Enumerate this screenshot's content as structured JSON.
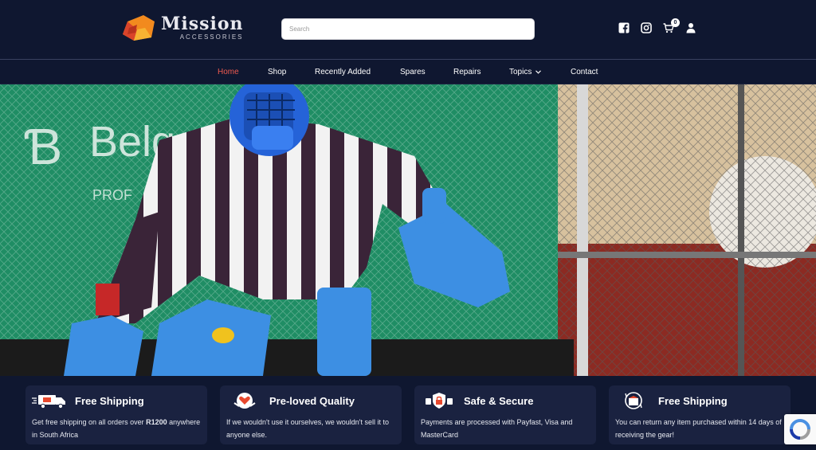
{
  "brand": {
    "name": "Mission",
    "tagline": "ACCESSORIES"
  },
  "search": {
    "placeholder": "Search",
    "value": ""
  },
  "header_icons": {
    "facebook": "facebook-icon",
    "instagram": "instagram-icon",
    "cart": "cart-icon",
    "account": "user-icon",
    "cart_count": "0"
  },
  "nav": {
    "items": [
      {
        "label": "Home",
        "active": true
      },
      {
        "label": "Shop"
      },
      {
        "label": "Recently Added"
      },
      {
        "label": "Spares"
      },
      {
        "label": "Repairs"
      },
      {
        "label": "Topics"
      },
      {
        "label": "Contact"
      }
    ]
  },
  "hero": {
    "image": "hockey goalkeeper in striped jersey and blue pads in front of green netting",
    "banner_text": "Belg ort",
    "banner_sub": "PROF"
  },
  "features": [
    {
      "icon": "shipping-truck-icon",
      "title": "Free Shipping",
      "text_before": "Get free shipping on all orders over ",
      "text_bold": "R1200",
      "text_after": " anywhere in South Africa"
    },
    {
      "icon": "heart-hands-icon",
      "title": "Pre-loved Quality",
      "text": "If we wouldn't use it ourselves, we wouldn't sell it to anyone else."
    },
    {
      "icon": "secure-lock-icon",
      "title": "Safe & Secure",
      "text": "Payments are processed with Payfast, Visa and MasterCard"
    },
    {
      "icon": "return-box-icon",
      "title": "Free Shipping",
      "text": "You can return any item purchased within 14 days of receiving the gear!"
    }
  ],
  "colors": {
    "background": "#0f1730",
    "card": "#1a2240",
    "active_nav": "#ef5a4f",
    "pad_blue": "#3d8fe3"
  }
}
